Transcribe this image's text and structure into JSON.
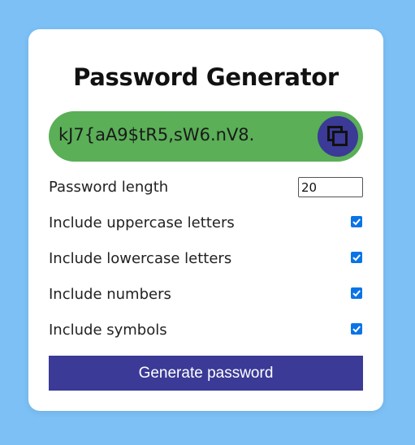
{
  "title": "Password Generator",
  "password": "kJ7{aA9$tR5,sW6.nV8.",
  "copy_icon": "copy-icon",
  "length": {
    "label": "Password length",
    "value": "20"
  },
  "options": [
    {
      "label": "Include uppercase letters",
      "checked": true
    },
    {
      "label": "Include lowercase letters",
      "checked": true
    },
    {
      "label": "Include numbers",
      "checked": true
    },
    {
      "label": "Include symbols",
      "checked": true
    }
  ],
  "generate_label": "Generate password",
  "colors": {
    "background": "#7cc0f5",
    "result": "#5aaf57",
    "accent": "#3b3a97",
    "checkbox": "#0a74e6"
  }
}
